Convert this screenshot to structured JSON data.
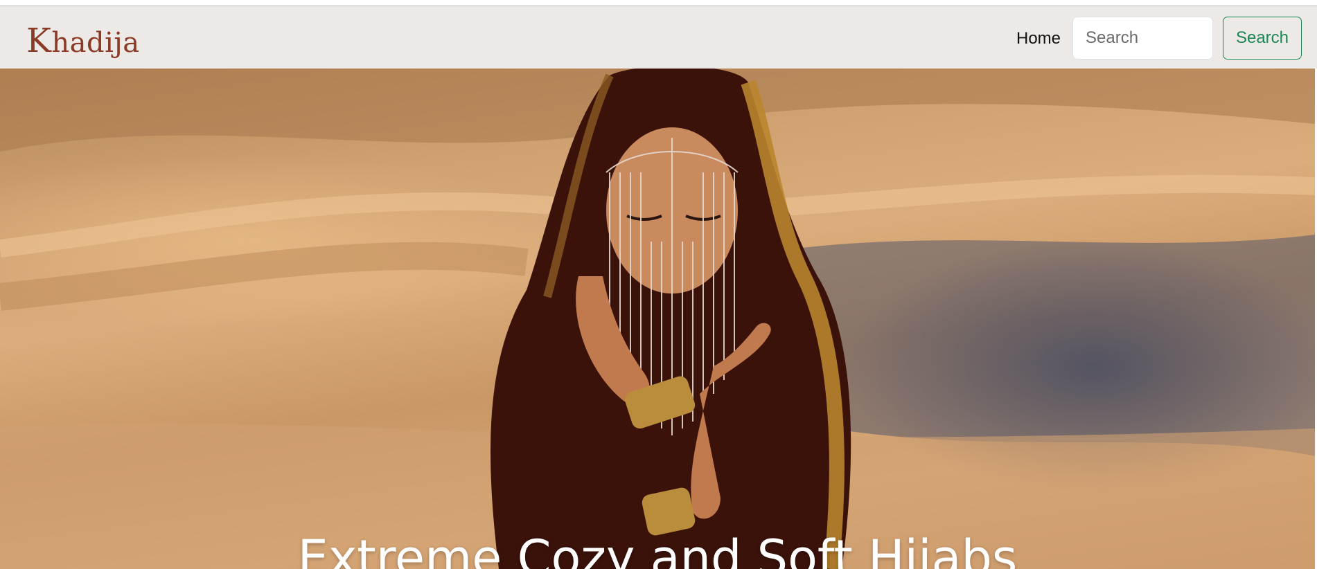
{
  "brand": {
    "first_letter": "K",
    "rest": "hadija"
  },
  "nav": {
    "home_label": "Home",
    "search_placeholder": "Search",
    "search_button_label": "Search"
  },
  "hero": {
    "heading": "Extreme Cozy and Soft Hijabs"
  },
  "colors": {
    "navbar_bg": "#ede9e6",
    "brand": "#8b3a26",
    "search_button": "#198754",
    "hero_sand": "#d4a574"
  },
  "icons": [
    "hero-photo"
  ]
}
